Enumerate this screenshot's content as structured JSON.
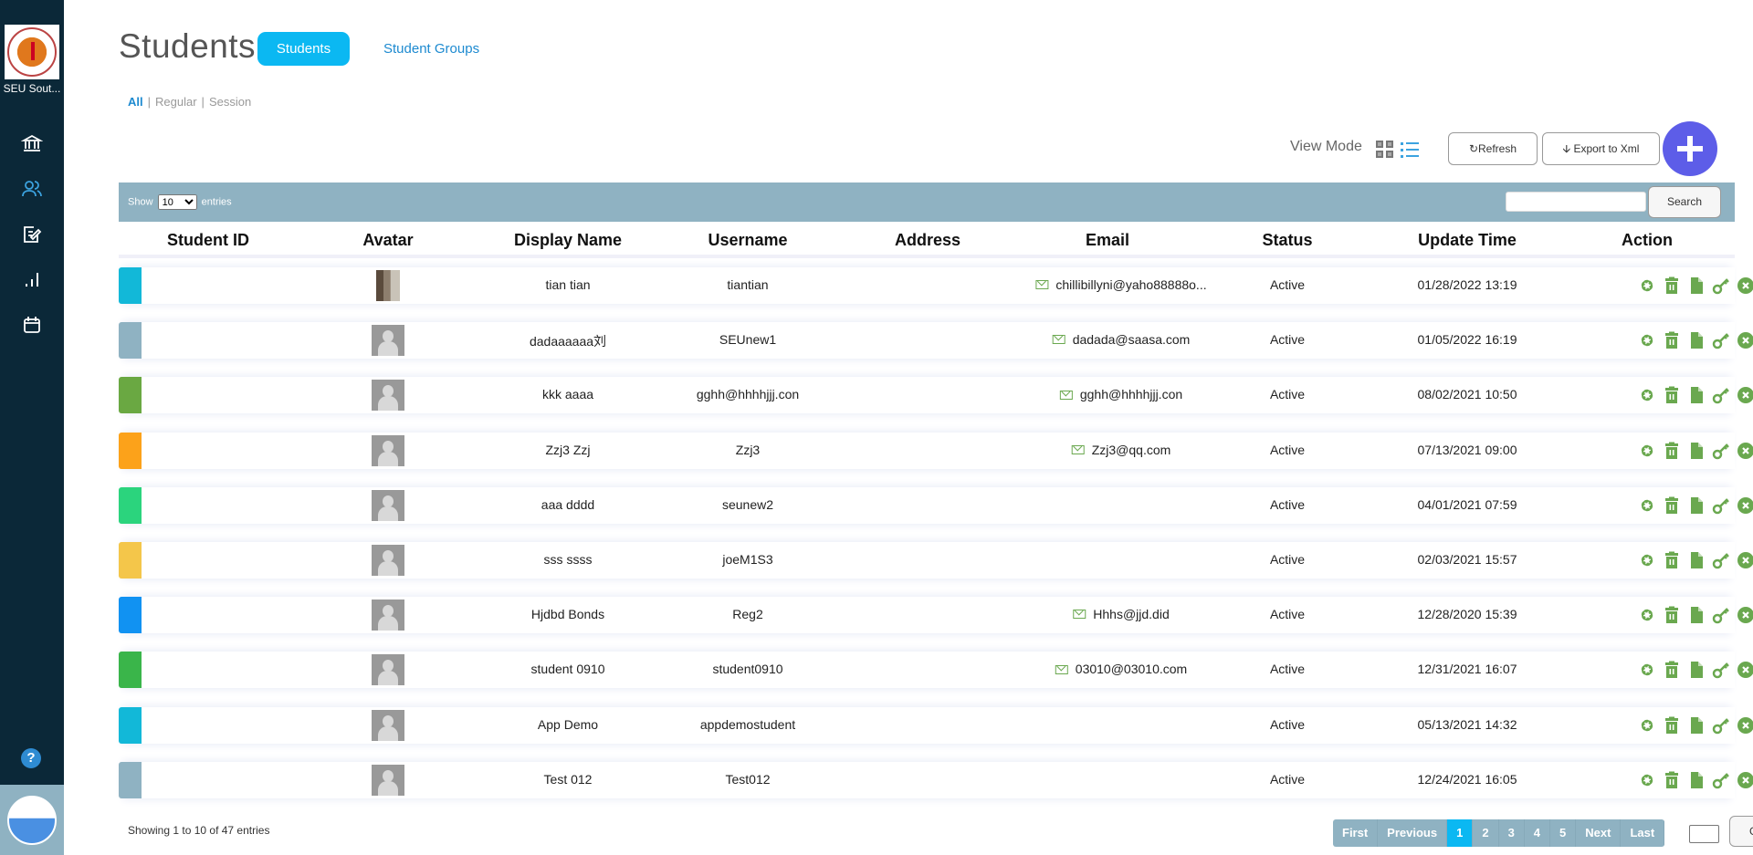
{
  "sidebar": {
    "school_name": "SEU Sout...",
    "nav": [
      {
        "icon": "institution-icon",
        "label": "Institution"
      },
      {
        "icon": "users-icon",
        "label": "Students",
        "active": true
      },
      {
        "icon": "edit-document-icon",
        "label": "Assignments"
      },
      {
        "icon": "bar-chart-icon",
        "label": "Reports"
      },
      {
        "icon": "calendar-icon",
        "label": "Calendar"
      }
    ],
    "help_label": "?"
  },
  "header": {
    "title": "Students",
    "tabs": [
      {
        "label": "Students",
        "active": true
      },
      {
        "label": "Student Groups",
        "active": false
      }
    ]
  },
  "filters": [
    {
      "label": "All",
      "active": true
    },
    {
      "label": "Regular",
      "active": false
    },
    {
      "label": "Session",
      "active": false
    }
  ],
  "toolbar": {
    "view_mode_label": "View Mode",
    "view_mode": "list",
    "refresh_label": "↻Refresh",
    "export_label": "🡫 Export to Xml",
    "add_icon": "plus-icon"
  },
  "table_controls": {
    "show_label": "Show",
    "entries_label": "entries",
    "page_size": "10",
    "search_value": "",
    "search_label": "Search"
  },
  "columns": [
    "Student ID",
    "Avatar",
    "Display Name",
    "Username",
    "Address",
    "Email",
    "Status",
    "Update Time",
    "Action"
  ],
  "rows": [
    {
      "color": "#12b8d8",
      "student_id": "",
      "avatar": "photo",
      "display_name": "tian tian",
      "username": "tiantian",
      "address": "",
      "email": "chillibillyni@yaho88888o...",
      "status": "Active",
      "update_time": "01/28/2022 13:19"
    },
    {
      "color": "#8fb2c2",
      "student_id": "",
      "avatar": "default",
      "display_name": "dadaaaaaa刘",
      "username": "SEUnew1",
      "address": "",
      "email": "dadada@saasa.com",
      "status": "Active",
      "update_time": "01/05/2022 16:19"
    },
    {
      "color": "#6aa842",
      "student_id": "",
      "avatar": "default",
      "display_name": "kkk aaaa",
      "username": "gghh@hhhhjjj.con",
      "address": "",
      "email": "gghh@hhhhjjj.con",
      "status": "Active",
      "update_time": "08/02/2021 10:50"
    },
    {
      "color": "#fca21a",
      "student_id": "",
      "avatar": "default",
      "display_name": "Zzj3 Zzj",
      "username": "Zzj3",
      "address": "",
      "email": "Zzj3@qq.com",
      "status": "Active",
      "update_time": "07/13/2021 09:00"
    },
    {
      "color": "#2bd47d",
      "student_id": "",
      "avatar": "default",
      "display_name": "aaa dddd",
      "username": "seunew2",
      "address": "",
      "email": "",
      "status": "Active",
      "update_time": "04/01/2021 07:59"
    },
    {
      "color": "#f4c64a",
      "student_id": "",
      "avatar": "default",
      "display_name": "sss ssss",
      "username": "joeM1S3",
      "address": "",
      "email": "",
      "status": "Active",
      "update_time": "02/03/2021 15:57"
    },
    {
      "color": "#1192f2",
      "student_id": "",
      "avatar": "default",
      "display_name": "Hjdbd Bonds",
      "username": "Reg2",
      "address": "",
      "email": "Hhhs@jjd.did",
      "status": "Active",
      "update_time": "12/28/2020 15:39"
    },
    {
      "color": "#3ab54a",
      "student_id": "",
      "avatar": "default",
      "display_name": "student 0910",
      "username": "student0910",
      "address": "",
      "email": "03010@03010.com",
      "status": "Active",
      "update_time": "12/31/2021 16:07"
    },
    {
      "color": "#12b8d8",
      "student_id": "",
      "avatar": "default",
      "display_name": "App Demo",
      "username": "appdemostudent",
      "address": "",
      "email": "",
      "status": "Active",
      "update_time": "05/13/2021 14:32"
    },
    {
      "color": "#8fb2c2",
      "student_id": "",
      "avatar": "default",
      "display_name": "Test 012",
      "username": "Test012",
      "address": "",
      "email": "",
      "status": "Active",
      "update_time": "12/24/2021 16:05"
    }
  ],
  "row_actions": [
    "settings-icon",
    "delete-icon",
    "file-icon",
    "key-icon",
    "close-circle-icon"
  ],
  "colors": {
    "sidebar": "#0b2838",
    "accent": "#0bb8f2",
    "table_bar": "#8fb2c2",
    "action_green": "#6aa84f",
    "add_button": "#5d5de8"
  },
  "footer": {
    "info": "Showing 1 to 10 of 47 entries",
    "pages": [
      "First",
      "Previous",
      "1",
      "2",
      "3",
      "4",
      "5",
      "Next",
      "Last"
    ],
    "current_page": "1",
    "goto_value": "",
    "go_label": "Go"
  }
}
